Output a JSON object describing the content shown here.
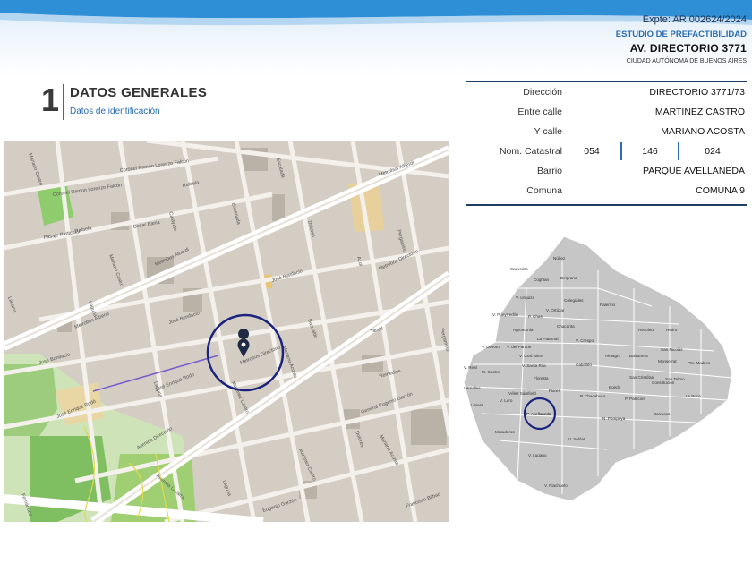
{
  "header": {
    "expte": "Expte: AR 002624/2024",
    "estudio": "ESTUDIO DE PREFACTIBILIDAD",
    "address": "AV. DIRECTORIO 3771",
    "city": "CIUDAD AUTÓNOMA DE BUENOS AIRES"
  },
  "section": {
    "number": "1",
    "title": "DATOS GENERALES",
    "subtitle": "Datos de identificación"
  },
  "info": {
    "direccion_label": "Dirección",
    "direccion_value": "DIRECTORIO 3771/73",
    "entre_label": "Entre calle",
    "entre_value": "MARTINEZ CASTRO",
    "ycalle_label": "Y calle",
    "ycalle_value": "MARIANO ACOSTA",
    "catastral_label": "Nom. Catastral",
    "catastral_values": [
      "054",
      "146",
      "024"
    ],
    "barrio_label": "Barrio",
    "barrio_value": "PARQUE AVELLANEDA",
    "comuna_label": "Comuna",
    "comuna_value": "COMUNA 9"
  },
  "street_map": {
    "streets": [
      "Coronel Ramón Lorenzo Falcón",
      "Coronel Ramon Lorenzo Falcón",
      "Rafaela",
      "Cesar Bania",
      "Metrobus Alberdi",
      "José Bonifacio",
      "Metrobús Directorio",
      "Tandil",
      "Remedios",
      "Laguna",
      "Lacarra",
      "Mariano Acosta",
      "Martinez Castro",
      "Avenida Directorio",
      "Avenida Lacarra",
      "José Enrique Rodó",
      "General Eugenio Garzón",
      "Eugenio Garzón",
      "Francisco Bilbao",
      "Fernández",
      "Pasaje Particular",
      "Dolores",
      "Azul",
      "Basualdo",
      "Pergamino",
      "Escalada",
      "Ensenada",
      "Cafayate",
      "Cosquín",
      "Ordóñez",
      "Olivera",
      "Mozart",
      "Oruro",
      "Gualeguaychú",
      "Bragado",
      "Mariano Castro"
    ]
  },
  "comunas_map": {
    "barrios": [
      "Núñez",
      "Saavedra",
      "Coghlan",
      "Belgrano",
      "V. Urquiza",
      "Colegiales",
      "Palermo",
      "V. Pueyrredón",
      "V. Ortúzar",
      "P. Chas",
      "Agronomía",
      "Chacarita",
      "Recoleta",
      "Retiro",
      "La Paternal",
      "V. Crespo",
      "San Nicolás",
      "V. Devoto",
      "V. del Parque",
      "Almagro",
      "Balvanera",
      "Pto. Madero",
      "V. Gral. Mitre",
      "V. Real",
      "M. Castro",
      "V. Santa Rita",
      "Caballito",
      "Monserrat",
      "San Telmo",
      "Floresta",
      "San Cristóbal",
      "Constitución",
      "Versalles",
      "Vélez Sársfield",
      "Flores",
      "Boedo",
      "La Boca",
      "Liniers",
      "V. Luro",
      "P. Avellaneda",
      "P. Chacabuco",
      "P. Patricios",
      "Barracas",
      "Mataderos",
      "N. Pompeya",
      "V. Soldati",
      "V. Lugano",
      "V. Riachuelo"
    ],
    "highlighted": "P. Avellaneda",
    "highlight_color": "#1a237e"
  },
  "colors": {
    "accent": "#2b6cb0",
    "dark": "#1e3e66",
    "marker": "#1a237e"
  }
}
